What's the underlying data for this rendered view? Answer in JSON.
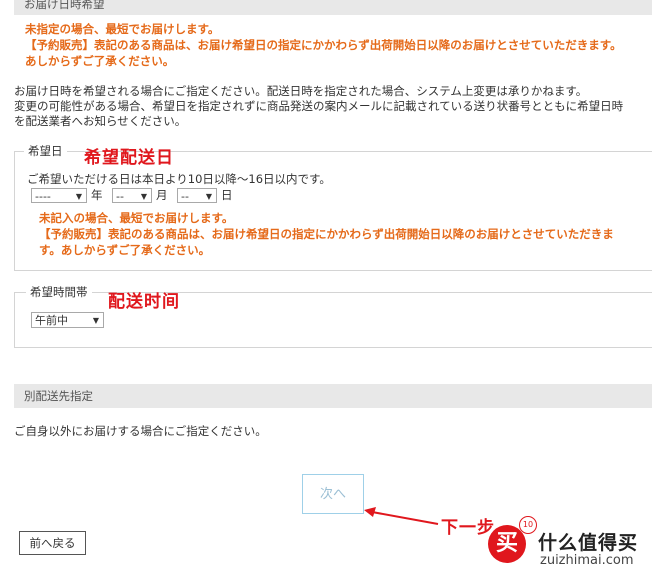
{
  "delivery_section": {
    "title": "お届け日時希望",
    "warning_line1": "未指定の場合、最短でお届けします。",
    "warning_line2": "【予約販売】表記のある商品は、お届け希望日の指定にかかわらず出荷開始日以降のお届けとさせていただきます。",
    "warning_line3": "あしからずご了承ください。",
    "info_line1": "お届け日時を希望される場合にご指定ください。配送日時を指定された場合、システム上変更は承りかねます。",
    "info_line2": "変更の可能性がある場合、希望日を指定されずに商品発送の案内メールに記載されている送り状番号とともに希望日時",
    "info_line3": "を配送業者へお知らせください。"
  },
  "date_box": {
    "legend": "希望日",
    "annotation": "希望配送日",
    "instructions": "ご希望いただける日は本日より10日以降～16日以内です。",
    "year_value": "----",
    "year_label": "年",
    "month_value": "--",
    "month_label": "月",
    "day_value": "--",
    "day_label": "日",
    "warning_line1": "未記入の場合、最短でお届けします。",
    "warning_line2": "【予約販売】表記のある商品は、お届け希望日の指定にかかわらず出荷開始日以降のお届けとさせていただきま",
    "warning_line3": "す。あしからずご了承ください。"
  },
  "time_box": {
    "legend": "希望時間帯",
    "annotation": "配送时间",
    "time_value": "午前中"
  },
  "alt_address": {
    "title": "別配送先指定",
    "info": "ご自身以外にお届けする場合にご指定ください。"
  },
  "buttons": {
    "next_label": "次へ",
    "prev_label": "前へ戻る"
  },
  "annotations": {
    "next_step": "下一步"
  },
  "watermark": {
    "badge_char": "买",
    "badge_num": "10",
    "brand_cn": "什么值得买",
    "brand_url": "zuizhimai.com"
  },
  "colors": {
    "warning": "#e56a1a",
    "annotation": "#e0171d",
    "section_bar": "#e8e8e8",
    "next_border": "#9fd0e8"
  }
}
